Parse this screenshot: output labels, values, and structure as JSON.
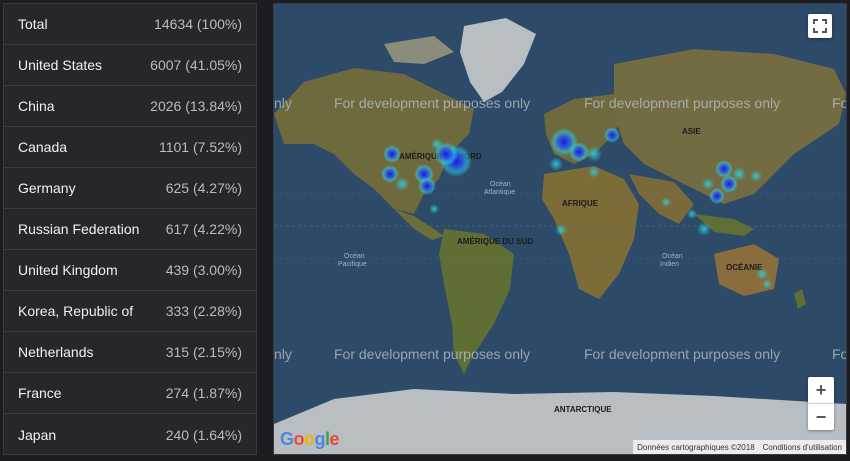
{
  "stats": {
    "rows": [
      {
        "country": "Total",
        "count": "14634 (100%)"
      },
      {
        "country": "United States",
        "count": "6007 (41.05%)"
      },
      {
        "country": "China",
        "count": "2026 (13.84%)"
      },
      {
        "country": "Canada",
        "count": "1101 (7.52%)"
      },
      {
        "country": "Germany",
        "count": "625 (4.27%)"
      },
      {
        "country": "Russian Federation",
        "count": "617 (4.22%)"
      },
      {
        "country": "United Kingdom",
        "count": "439 (3.00%)"
      },
      {
        "country": "Korea, Republic of",
        "count": "333 (2.28%)"
      },
      {
        "country": "Netherlands",
        "count": "315 (2.15%)"
      },
      {
        "country": "France",
        "count": "274 (1.87%)"
      },
      {
        "country": "Japan",
        "count": "240 (1.64%)"
      }
    ]
  },
  "map": {
    "watermark": "For development purposes only",
    "watermark_cut_left": "nly",
    "watermark_cut_right": "Fo",
    "labels": {
      "north_america": "AMÉRIQUE DU NORD",
      "south_america": "AMÉRIQUE DU SUD",
      "africa": "AFRIQUE",
      "asia": "ASIE",
      "oceania": "OCÉANIE",
      "antarctica": "ANTARCTIQUE",
      "atlantic_1": "Océan",
      "atlantic_2": "Atlantique",
      "pacific_1": "Océan",
      "pacific_2": "Pacifique",
      "indian_1": "Océan",
      "indian_2": "Indien"
    },
    "controls": {
      "zoom_in": "+",
      "zoom_out": "−"
    },
    "attribution": {
      "data": "Données cartographiques ©2018",
      "terms": "Conditions d'utilisation"
    },
    "logo": {
      "g1": "G",
      "o1": "o",
      "o2": "o",
      "g2": "g",
      "l": "l",
      "e": "e"
    },
    "colors": {
      "ocean": "#2d4a68",
      "land": "#6f6a3e",
      "ice": "#b9bec3",
      "heat_core": "#1a1ad0",
      "heat_glow": "#2bd4e6"
    }
  }
}
